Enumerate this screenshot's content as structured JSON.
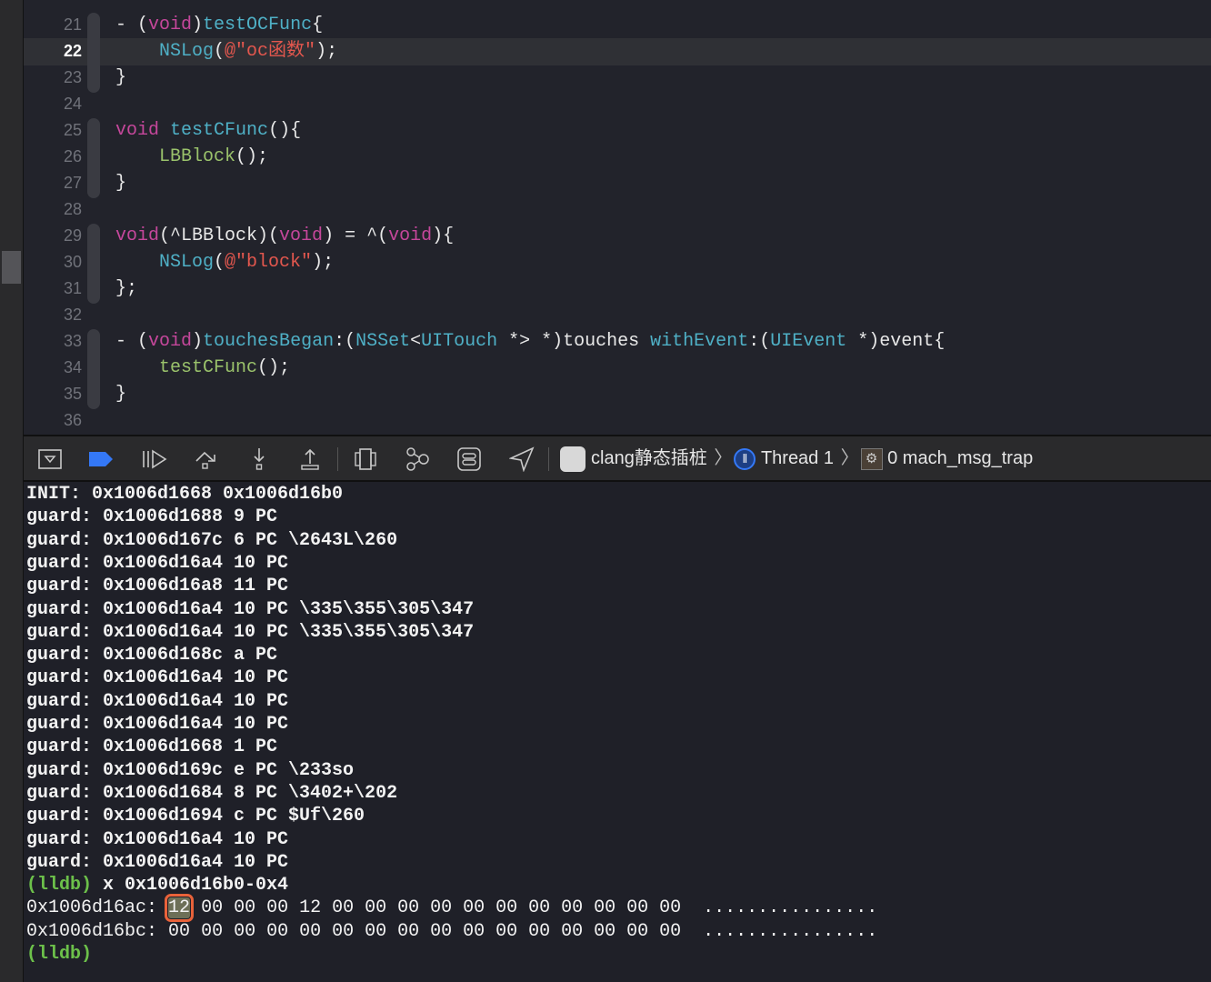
{
  "editor": {
    "current_line": 22,
    "lines": [
      {
        "n": 21,
        "tokens": [
          [
            "- (",
            "plain"
          ],
          [
            "void",
            "kw"
          ],
          [
            ")",
            "plain"
          ],
          [
            "testOCFunc",
            "fn"
          ],
          [
            "{",
            "plain"
          ]
        ]
      },
      {
        "n": 22,
        "tokens": [
          [
            "    ",
            "plain"
          ],
          [
            "NSLog",
            "fn"
          ],
          [
            "(",
            "plain"
          ],
          [
            "@\"oc函数\"",
            "str"
          ],
          [
            ");",
            "plain"
          ]
        ]
      },
      {
        "n": 23,
        "tokens": [
          [
            "}",
            "plain"
          ]
        ]
      },
      {
        "n": 24,
        "tokens": []
      },
      {
        "n": 25,
        "tokens": [
          [
            "void",
            "kw"
          ],
          [
            " ",
            "plain"
          ],
          [
            "testCFunc",
            "fn"
          ],
          [
            "(){",
            "plain"
          ]
        ]
      },
      {
        "n": 26,
        "tokens": [
          [
            "    ",
            "plain"
          ],
          [
            "LBBlock",
            "call"
          ],
          [
            "();",
            "plain"
          ]
        ]
      },
      {
        "n": 27,
        "tokens": [
          [
            "}",
            "plain"
          ]
        ]
      },
      {
        "n": 28,
        "tokens": []
      },
      {
        "n": 29,
        "tokens": [
          [
            "void",
            "kw"
          ],
          [
            "(^LBBlock)(",
            "plain"
          ],
          [
            "void",
            "kw"
          ],
          [
            ") = ^(",
            "plain"
          ],
          [
            "void",
            "kw"
          ],
          [
            "){",
            "plain"
          ]
        ]
      },
      {
        "n": 30,
        "tokens": [
          [
            "    ",
            "plain"
          ],
          [
            "NSLog",
            "fn"
          ],
          [
            "(",
            "plain"
          ],
          [
            "@\"block\"",
            "str"
          ],
          [
            ");",
            "plain"
          ]
        ]
      },
      {
        "n": 31,
        "tokens": [
          [
            "};",
            "plain"
          ]
        ]
      },
      {
        "n": 32,
        "tokens": []
      },
      {
        "n": 33,
        "tokens": [
          [
            "- (",
            "plain"
          ],
          [
            "void",
            "kw"
          ],
          [
            ")",
            "plain"
          ],
          [
            "touchesBegan",
            "fn"
          ],
          [
            ":(",
            "plain"
          ],
          [
            "NSSet",
            "fn"
          ],
          [
            "<",
            "plain"
          ],
          [
            "UITouch",
            "fn"
          ],
          [
            " *> *)touches ",
            "plain"
          ],
          [
            "withEvent",
            "fn"
          ],
          [
            ":(",
            "plain"
          ],
          [
            "UIEvent",
            "fn"
          ],
          [
            " *)event{",
            "plain"
          ]
        ]
      },
      {
        "n": 34,
        "tokens": [
          [
            "    ",
            "plain"
          ],
          [
            "testCFunc",
            "call"
          ],
          [
            "();",
            "plain"
          ]
        ]
      },
      {
        "n": 35,
        "tokens": [
          [
            "}",
            "plain"
          ]
        ]
      },
      {
        "n": 36,
        "tokens": []
      }
    ]
  },
  "debug_bar": {
    "buttons": [
      "hide-debug-area",
      "breakpoints-toggle",
      "continue",
      "step-over",
      "step-into",
      "step-out",
      "view-debugger",
      "memory-graph",
      "environment-overrides",
      "simulate-location"
    ],
    "breakpoint_color": "#3478f6",
    "breadcrumb": {
      "app": "clang静态插桩",
      "thread": "Thread 1",
      "frame": "0 mach_msg_trap"
    }
  },
  "console": {
    "lines": [
      "INIT: 0x1006d1668 0x1006d16b0",
      "guard: 0x1006d1688 9 PC",
      "guard: 0x1006d167c 6 PC \\2643L\\260",
      "guard: 0x1006d16a4 10 PC",
      "guard: 0x1006d16a8 11 PC",
      "guard: 0x1006d16a4 10 PC \\335\\355\\305\\347",
      "guard: 0x1006d16a4 10 PC \\335\\355\\305\\347",
      "guard: 0x1006d168c a PC",
      "guard: 0x1006d16a4 10 PC",
      "guard: 0x1006d16a4 10 PC",
      "guard: 0x1006d16a4 10 PC",
      "guard: 0x1006d1668 1 PC",
      "guard: 0x1006d169c e PC \\233so",
      "guard: 0x1006d1684 8 PC \\3402+\\202",
      "guard: 0x1006d1694 c PC $Uf\\260",
      "guard: 0x1006d16a4 10 PC",
      "guard: 0x1006d16a4 10 PC"
    ],
    "prompt": "(lldb)",
    "command": " x 0x1006d16b0-0x4",
    "memory": [
      {
        "addr": "0x1006d16ac:",
        "first": "12",
        "rest": " 00 00 00 12 00 00 00 00 00 00 00 00 00 00 00",
        "ascii": "  ................"
      },
      {
        "addr": "0x1006d16bc:",
        "first": "00",
        "rest": " 00 00 00 00 00 00 00 00 00 00 00 00 00 00 00",
        "ascii": "  ................"
      }
    ],
    "highlight_color": "#e8623a"
  }
}
